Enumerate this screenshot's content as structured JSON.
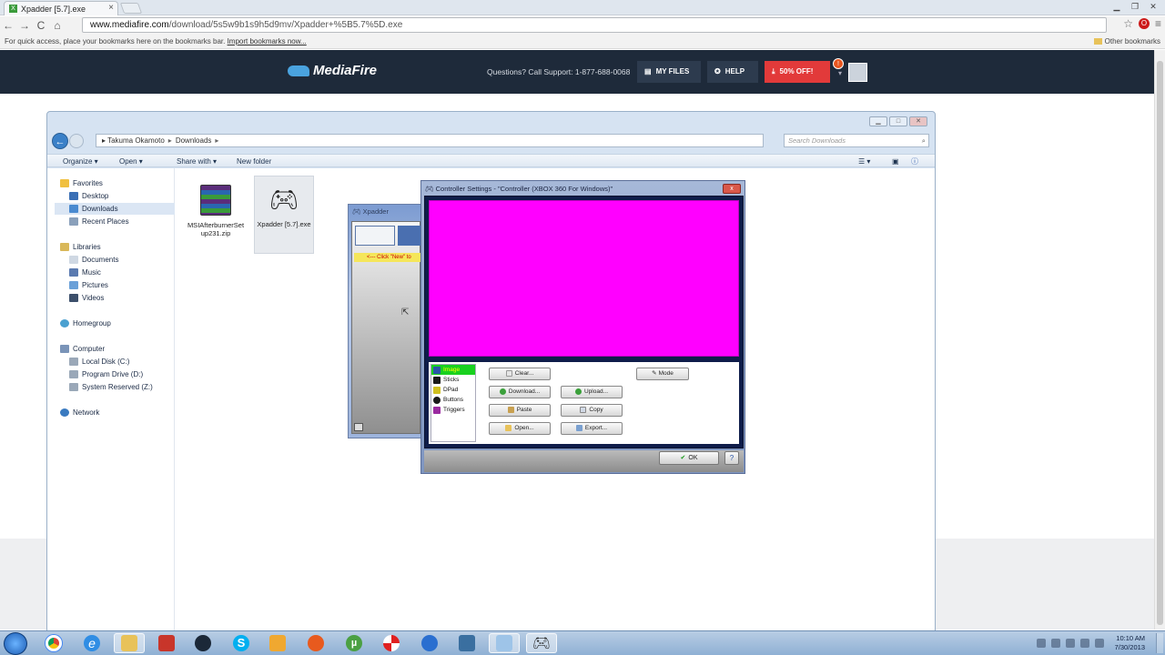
{
  "browser": {
    "tab_title": "Xpadder [5.7].exe",
    "tab_close": "×",
    "url_domain": "www.mediafire.com",
    "url_path": "/download/5s5w9b1s9h5d9mv/Xpadder+%5B5.7%5D.exe",
    "bookmarks_hint": "For quick access, place your bookmarks here on the bookmarks bar.",
    "import_bookmarks": "Import bookmarks now...",
    "other_bookmarks": "Other bookmarks",
    "nav": {
      "back": "←",
      "forward": "→",
      "reload": "C",
      "home": "⌂"
    }
  },
  "mediafire": {
    "logo": "MediaFire",
    "support": "Questions? Call Support: 1-877-688-0068",
    "my_files": "MY FILES",
    "help": "HELP",
    "offer": "50% OFF!",
    "badge": "!"
  },
  "explorer": {
    "crumbs": [
      "Takuma Okamoto",
      "Downloads"
    ],
    "search_placeholder": "Search Downloads",
    "toolbar": {
      "organize": "Organize ▾",
      "open": "Open ▾",
      "share": "Share with ▾",
      "new_folder": "New folder"
    },
    "nav": {
      "favorites": "Favorites",
      "desktop": "Desktop",
      "downloads": "Downloads",
      "recent": "Recent Places",
      "libraries": "Libraries",
      "documents": "Documents",
      "music": "Music",
      "pictures": "Pictures",
      "videos": "Videos",
      "homegroup": "Homegroup",
      "computer": "Computer",
      "local_disk": "Local Disk (C:)",
      "program_drive": "Program Drive (D:)",
      "system_reserved": "System Reserved (Z:)",
      "network": "Network"
    },
    "files": [
      {
        "name": "MSIAfterburnerSetup231.zip"
      },
      {
        "name": "Xpadder [5.7].exe"
      }
    ]
  },
  "xpadder": {
    "title": "Xpadder",
    "hint": "<--- Click \"New\" to"
  },
  "controller_dialog": {
    "title": "Controller Settings - \"Controller (XBOX 360 For Windows)\"",
    "close": "x",
    "categories": [
      "Image",
      "Sticks",
      "DPad",
      "Buttons",
      "Triggers"
    ],
    "buttons": {
      "clear": "Clear...",
      "download": "Download...",
      "upload": "Upload...",
      "paste": "Paste",
      "copy": "Copy",
      "open": "Open...",
      "export": "Export...",
      "mode": "Mode"
    },
    "ok": "OK",
    "help": "?"
  },
  "taskbar": {
    "time": "10:10 AM",
    "date": "7/30/2013"
  },
  "colors": {
    "mediafire_header": "#1e2a3a",
    "offer_red": "#e23a3a",
    "image_magenta": "#ff00ff",
    "selected_green": "#19d11f"
  }
}
